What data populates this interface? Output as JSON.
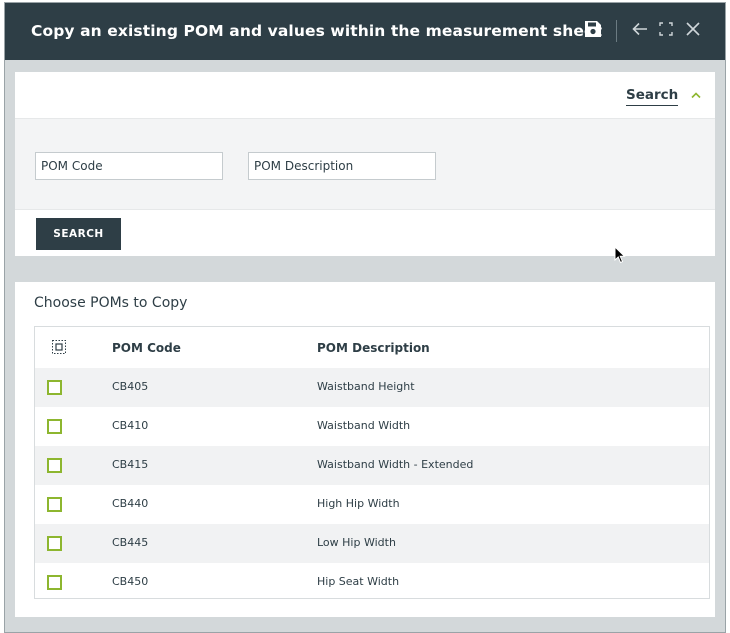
{
  "dialog": {
    "title": "Copy an existing POM and values within the measurement sheet",
    "icons": [
      "save-icon",
      "back-arrow-icon",
      "fullscreen-icon",
      "close-icon"
    ]
  },
  "search": {
    "toggle_label": "Search",
    "code_placeholder": "POM Code",
    "description_placeholder": "POM Description",
    "button_label": "SEARCH"
  },
  "list": {
    "title": "Choose POMs to Copy",
    "headers": {
      "code": "POM Code",
      "description": "POM Description"
    },
    "rows": [
      {
        "code": "CB405",
        "description": "Waistband Height"
      },
      {
        "code": "CB410",
        "description": "Waistband Width"
      },
      {
        "code": "CB415",
        "description": "Waistband Width - Extended"
      },
      {
        "code": "CB440",
        "description": "High Hip Width"
      },
      {
        "code": "CB445",
        "description": "Low Hip Width"
      },
      {
        "code": "CB450",
        "description": "Hip Seat Width"
      }
    ]
  },
  "colors": {
    "header_bg": "#2e3e46",
    "accent": "#8db62f",
    "panel_bg": "#d3d8da"
  }
}
